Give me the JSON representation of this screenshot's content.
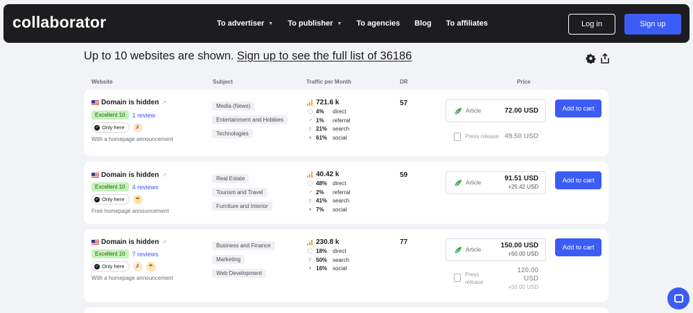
{
  "nav": {
    "logo": "collaborator",
    "items": [
      {
        "label": "To advertiser",
        "dropdown": true
      },
      {
        "label": "To publisher",
        "dropdown": true
      },
      {
        "label": "To agencies",
        "dropdown": false
      },
      {
        "label": "Blog",
        "dropdown": false
      },
      {
        "label": "To affiliates",
        "dropdown": false
      }
    ],
    "login_label": "Log in",
    "signup_label": "Sign up"
  },
  "headline": {
    "text": "Up to 10 websites are shown.",
    "link": "Sign up to see the full list of 36186"
  },
  "table": {
    "headers": {
      "website": "Website",
      "subject": "Subject",
      "traffic": "Traffic per Month",
      "dr": "DR",
      "price": "Price"
    },
    "add_to_cart_label": "Add to cart",
    "rows": [
      {
        "domain": "Domain is hidden",
        "rating": "Excellent 10",
        "reviews": "1 review",
        "only_here": "Only here",
        "announcement": "With a homepage announcement",
        "subjects": [
          "Media (News)",
          "Entertainment and Hobbies",
          "Technologies"
        ],
        "traffic_total": "721.6 k",
        "traffic": [
          {
            "icon": "direct-icon",
            "pct": "4%",
            "label": "direct"
          },
          {
            "icon": "referral-icon",
            "pct": "1%",
            "label": "referral"
          },
          {
            "icon": "search-icon",
            "pct": "21%",
            "label": "search"
          },
          {
            "icon": "social-icon",
            "pct": "61%",
            "label": "social"
          }
        ],
        "dr": "57",
        "article_label": "Article",
        "article_price": "72.00 USD",
        "article_extra": "",
        "press_label": "Press release",
        "press_price": "49.50 USD",
        "press_extra": ""
      },
      {
        "domain": "Domain is hidden",
        "rating": "Excellent 10",
        "reviews": "4 reviews",
        "only_here": "Only here",
        "announcement": "Free homepage announcement",
        "subjects": [
          "Real Estate",
          "Tourism and Travel",
          "Furniture and Interior"
        ],
        "traffic_total": "40.42 k",
        "traffic": [
          {
            "icon": "direct-icon",
            "pct": "48%",
            "label": "direct"
          },
          {
            "icon": "referral-icon",
            "pct": "2%",
            "label": "referral"
          },
          {
            "icon": "search-icon",
            "pct": "41%",
            "label": "search"
          },
          {
            "icon": "social-icon",
            "pct": "7%",
            "label": "social"
          }
        ],
        "dr": "59",
        "article_label": "Article",
        "article_price": "91.51 USD",
        "article_extra": "+25.42 USD"
      },
      {
        "domain": "Domain is hidden",
        "rating": "Excellent 10",
        "reviews": "7 reviews",
        "only_here": "Only here",
        "announcement": "With a homepage announcement",
        "subjects": [
          "Business and Finance",
          "Marketing",
          "Web Development"
        ],
        "traffic_total": "230.8 k",
        "traffic": [
          {
            "icon": "direct-icon",
            "pct": "18%",
            "label": "direct"
          },
          {
            "icon": "search-icon",
            "pct": "50%",
            "label": "search"
          },
          {
            "icon": "social-icon",
            "pct": "16%",
            "label": "social"
          }
        ],
        "dr": "77",
        "article_label": "Article",
        "article_price_line1": "150.00 USD",
        "article_extra": "+50.00 USD",
        "press_label_line1": "Press",
        "press_label_line2": "release",
        "press_price_line1": "120.00",
        "press_price_line2": "USD",
        "press_extra": "+50.00 USD"
      }
    ]
  },
  "colors": {
    "accent": "#3c5cf6",
    "nav_bg": "#1d1d20",
    "badge_bg": "#c6f3b7",
    "traffic_bars": "#f2a53a",
    "page_bg": "#f2f3f6"
  }
}
